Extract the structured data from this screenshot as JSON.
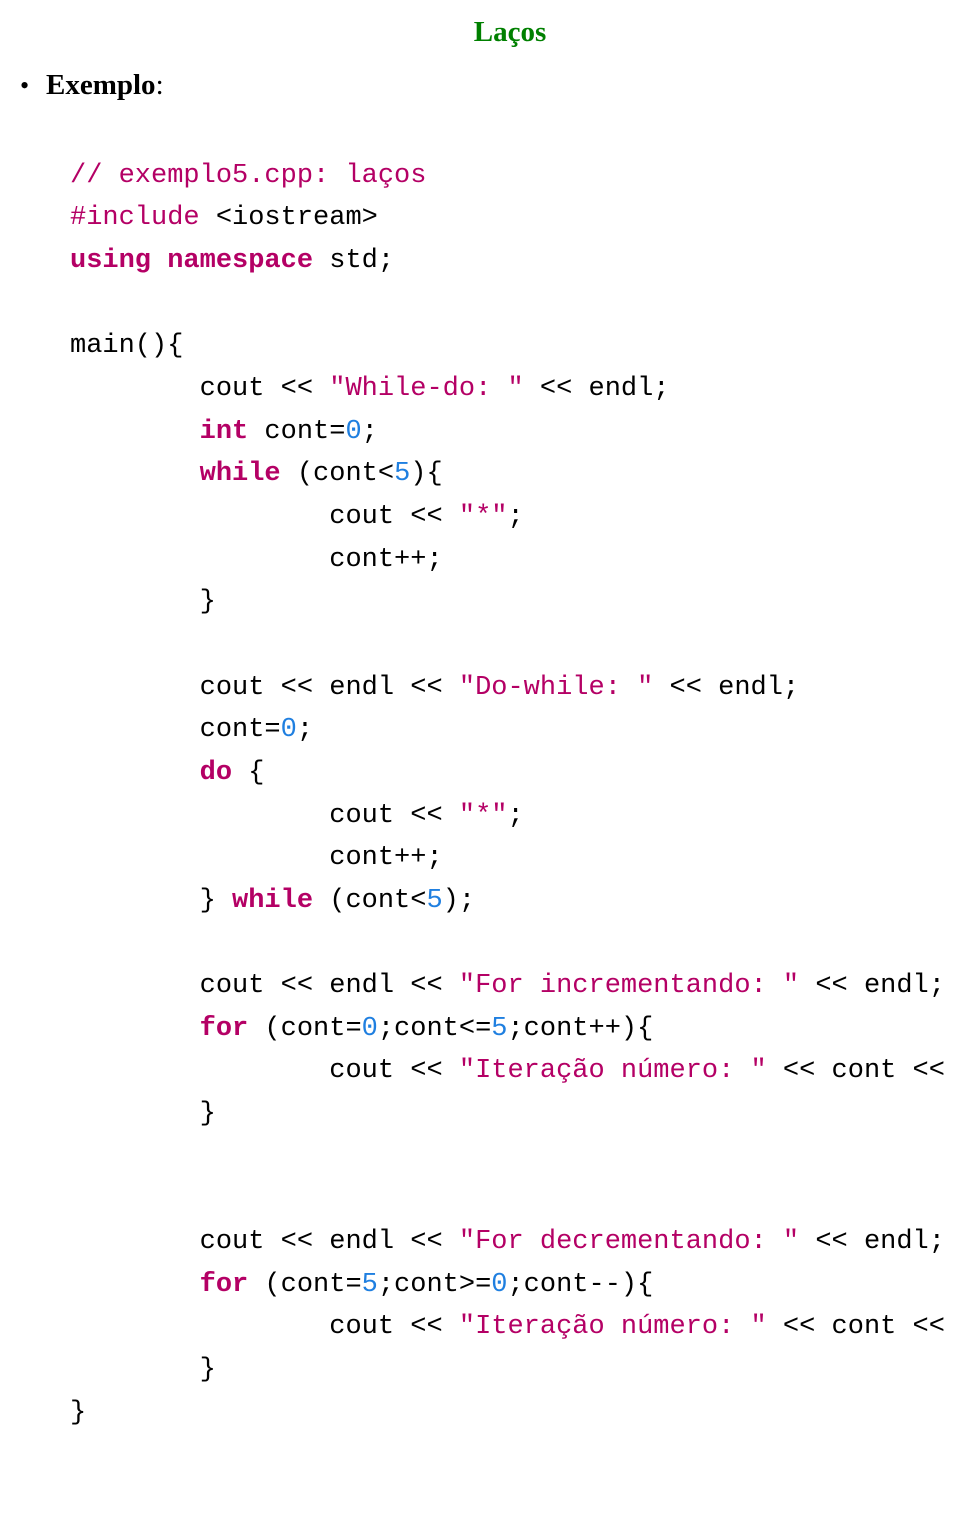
{
  "title": "Laços",
  "exampleLabel": "Exemplo",
  "colon": ":",
  "code": {
    "c1": "// exemplo5.cpp: laços",
    "inc1": "#include",
    "inc2": " <iostream>",
    "using1": "using namespace",
    "using2": " std;",
    "main": "main(){",
    "l1a": "        cout << ",
    "l1b": "\"While-do: \"",
    "l1c": " << endl;",
    "l2a": "        ",
    "l2b": "int",
    "l2c": " cont=",
    "l2d": "0",
    "l2e": ";",
    "l3a": "        ",
    "l3b": "while",
    "l3c": " (cont<",
    "l3d": "5",
    "l3e": "){",
    "l4a": "                cout << ",
    "l4b": "\"*\"",
    "l4c": ";",
    "l5": "                cont++;",
    "l6": "        }",
    "blank": " ",
    "l7a": "        cout << endl << ",
    "l7b": "\"Do-while: \"",
    "l7c": " << endl;",
    "l8a": "        cont=",
    "l8b": "0",
    "l8c": ";",
    "l9a": "        ",
    "l9b": "do",
    "l9c": " {",
    "l10a": "                cout << ",
    "l10b": "\"*\"",
    "l10c": ";",
    "l11": "                cont++;",
    "l12a": "        } ",
    "l12b": "while",
    "l12c": " (cont<",
    "l12d": "5",
    "l12e": ");",
    "l13a": "        cout << endl << ",
    "l13b": "\"For incrementando: \"",
    "l13c": " << endl;",
    "l14a": "        ",
    "l14b": "for",
    "l14c": " (cont=",
    "l14d": "0",
    "l14e": ";cont<=",
    "l14f": "5",
    "l14g": ";cont++){",
    "l15a": "                cout << ",
    "l15b": "\"Iteração número: \"",
    "l15c": " << cont << endl;",
    "l16": "        }",
    "l17a": "        cout << endl << ",
    "l17b": "\"For decrementando: \"",
    "l17c": " << endl;",
    "l18a": "        ",
    "l18b": "for",
    "l18c": " (cont=",
    "l18d": "5",
    "l18e": ";cont>=",
    "l18f": "0",
    "l18g": ";cont--){",
    "l19a": "                cout << ",
    "l19b": "\"Iteração número: \"",
    "l19c": " << cont << endl;",
    "l20": "        }",
    "end": "}"
  }
}
